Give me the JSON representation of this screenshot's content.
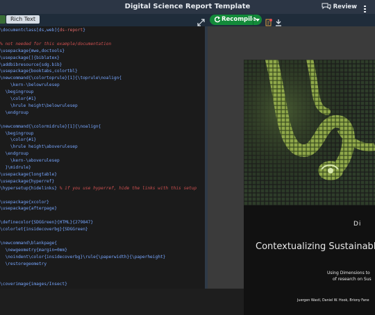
{
  "app": {
    "title": "Digital Science Report Template",
    "review_label": "Review"
  },
  "toolbar": {
    "rich_text_label": "Rich Text",
    "recompile_label": "Recompile"
  },
  "editor": {
    "lines": [
      [
        {
          "t": "\\documentclass[ds,web]{",
          "c": "blue"
        },
        {
          "t": "ds-report",
          "c": "red"
        },
        {
          "t": "}",
          "c": "blue"
        }
      ],
      [],
      [
        {
          "t": "% not needed for this example/documentation",
          "c": "comment"
        }
      ],
      [
        {
          "t": "\\usepackage{mwe,doctools}",
          "c": "blue"
        }
      ],
      [
        {
          "t": "\\usepackage[]{biblatex}",
          "c": "blue"
        }
      ],
      [
        {
          "t": "\\addbibresource{sdg.bib}",
          "c": "blue"
        }
      ],
      [
        {
          "t": "\\usepackage{booktabs,colortbl}",
          "c": "blue"
        }
      ],
      [
        {
          "t": "\\newcommand{\\colortoprule}[1]{\\toprule\\noalign{",
          "c": "blue"
        }
      ],
      [
        {
          "t": "    \\kern-\\belowrulesep",
          "c": "blue"
        }
      ],
      [
        {
          "t": "  \\begingroup",
          "c": "blue"
        }
      ],
      [
        {
          "t": "    \\color{#1}",
          "c": "blue"
        }
      ],
      [
        {
          "t": "    \\hrule height\\belowrulesep",
          "c": "blue"
        }
      ],
      [
        {
          "t": "  \\endgroup",
          "c": "blue"
        }
      ],
      [],
      [
        {
          "t": "\\newcommand{\\colormidrule}[1]{\\noalign{",
          "c": "blue"
        }
      ],
      [
        {
          "t": "  \\begingroup",
          "c": "blue"
        }
      ],
      [
        {
          "t": "    \\color{#1}",
          "c": "blue"
        }
      ],
      [
        {
          "t": "    \\hrule height\\aboverulesep",
          "c": "blue"
        }
      ],
      [
        {
          "t": "  \\endgroup",
          "c": "blue"
        }
      ],
      [
        {
          "t": "    \\kern-\\aboverulesep",
          "c": "blue"
        }
      ],
      [
        {
          "t": "  }\\midrule}",
          "c": "blue"
        }
      ],
      [
        {
          "t": "\\usepackage{longtable}",
          "c": "blue"
        }
      ],
      [
        {
          "t": "\\usepackage{hyperref}",
          "c": "blue"
        }
      ],
      [
        {
          "t": "\\hypersetup{hidelinks} ",
          "c": "blue"
        },
        {
          "t": "% if you use hyperref, hide the links with this setup",
          "c": "comment"
        }
      ],
      [],
      [
        {
          "t": "\\usepackage{xcolor}",
          "c": "blue"
        }
      ],
      [
        {
          "t": "\\usepackage{afterpage}",
          "c": "blue"
        }
      ],
      [],
      [
        {
          "t": "\\definecolor{SDGGreen}{HTML}{279847}",
          "c": "blue"
        }
      ],
      [
        {
          "t": "\\colorlet{insidecoverbg}{SDGGreen}",
          "c": "blue"
        }
      ],
      [],
      [
        {
          "t": "\\newcommand\\blankpage{",
          "c": "blue"
        }
      ],
      [
        {
          "t": "  \\newgeometry{margin=0mm}",
          "c": "blue"
        }
      ],
      [
        {
          "t": "  \\noindent\\color{insidecoverbg}\\rule{\\paperwidth}{\\paperheight}",
          "c": "blue"
        }
      ],
      [
        {
          "t": "  \\restoregeometry",
          "c": "blue"
        }
      ],
      [],
      [],
      [
        {
          "t": "\\coverimage{images/Insect}",
          "c": "blue"
        }
      ]
    ]
  },
  "preview": {
    "subtitle_big": "Di",
    "title": "Contextualizing Sustainable",
    "desc_line1": "Using Dimensions to",
    "desc_line2": "of research on Sus",
    "authors": "Juergen Wastl, Daniel W. Hook, Briony Fane"
  },
  "colors": {
    "top_bar": "#2c3645",
    "toolbar": "#1f2c3a",
    "recompile": "#138a3a",
    "editor_bg": "#1b1b1b",
    "code_blue": "#77a6ff",
    "code_red": "#e06868"
  },
  "icons": {
    "review": "review-icon",
    "menu": "menu-icon",
    "expand": "expand-arrows-icon",
    "recompile": "recompile-arrow-icon",
    "logs": "logs-icon",
    "download": "download-icon"
  }
}
